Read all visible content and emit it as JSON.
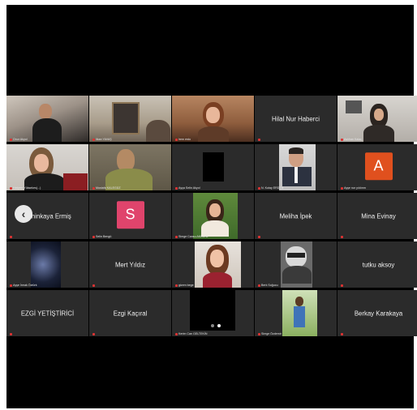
{
  "tiles": [
    {
      "name": "Onur Akyol",
      "big": ""
    },
    {
      "name": "Ilkan YAVAŞ",
      "big": ""
    },
    {
      "name": "lrem erdo",
      "big": ""
    },
    {
      "name": "",
      "big": "Hilal Nur Haberci"
    },
    {
      "name": "Aslıhan Kalaç",
      "big": ""
    },
    {
      "name": "Hatçem Yüksekes(...)",
      "big": ""
    },
    {
      "name": "Mustafa KALEGÜZ",
      "big": ""
    },
    {
      "name": "Ayça Selin Akyol",
      "big": ""
    },
    {
      "name": "N. Kutay ERDEN",
      "big": ""
    },
    {
      "name": "Ayşe nur yıldırım",
      "big": ""
    },
    {
      "name": "",
      "big": "Şahinkaya Ermiş"
    },
    {
      "name": "Selin Bengü",
      "big": ""
    },
    {
      "name": "Simge Cansu AKKAYA",
      "big": ""
    },
    {
      "name": "",
      "big": "Meliha İpek"
    },
    {
      "name": "",
      "big": "Mina Evinay"
    },
    {
      "name": "Ayşe İrmak Öztürk",
      "big": ""
    },
    {
      "name": "",
      "big": "Mert Yıldız"
    },
    {
      "name": "gizem bege",
      "big": ""
    },
    {
      "name": "Berk Soğucu",
      "big": ""
    },
    {
      "name": "",
      "big": "tutku aksoy"
    },
    {
      "name": "",
      "big": "EZGİ YETİŞTİRİCİ"
    },
    {
      "name": "",
      "big": "Ezgi Kaçıral"
    },
    {
      "name": "Kerim Can GELTEKİN",
      "big": ""
    },
    {
      "name": "Simge Özdemir",
      "big": ""
    },
    {
      "name": "",
      "big": "Berkay Karakaya"
    }
  ],
  "avatars": {
    "selin": {
      "letter": "S",
      "color": "#e0446c"
    },
    "ayse": {
      "letter": "A",
      "color": "#e0501e"
    }
  }
}
